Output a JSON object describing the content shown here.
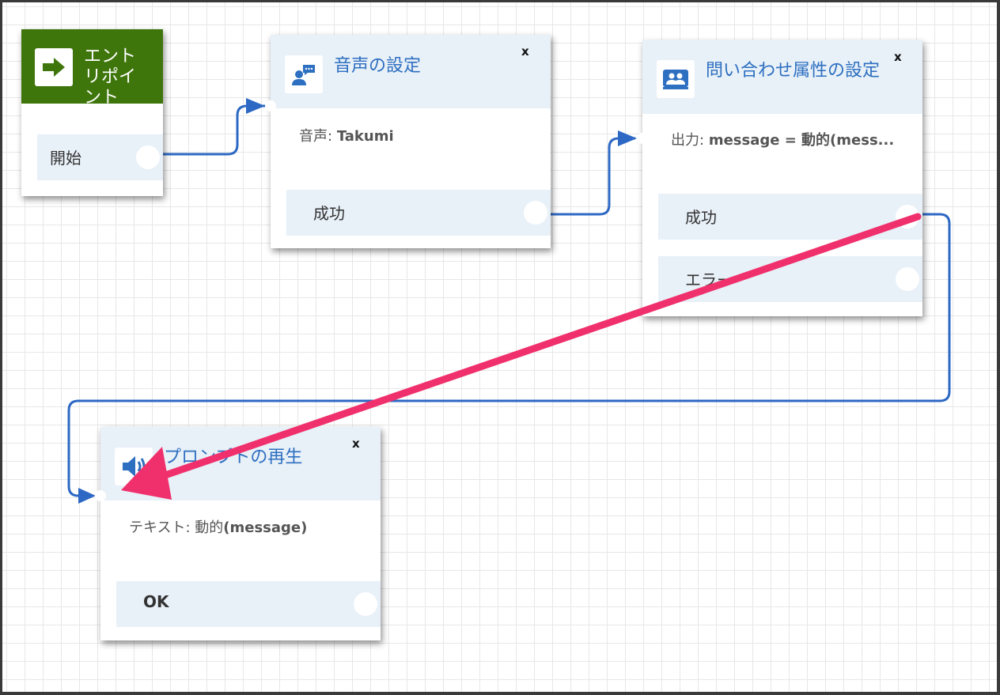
{
  "entry": {
    "title": "エントリポイント",
    "branch": "開始"
  },
  "voice": {
    "title": "音声の設定",
    "body_label": "音声:",
    "body_value": "Takumi",
    "close": "x",
    "branch": "成功"
  },
  "attrs": {
    "title": "問い合わせ属性の設定",
    "body_label": "出力:",
    "body_value": "message = 動的(mess...",
    "close": "x",
    "branches": [
      "成功",
      "エラー"
    ]
  },
  "prompt": {
    "title": "プロンプトの再生",
    "body_label": "テキスト: 動的",
    "body_value": "(message)",
    "close": "x",
    "branch": "OK"
  },
  "colors": {
    "entry_header": "#3f760c",
    "accent": "#2d6fc0",
    "wire": "#2d68c4",
    "arrow": "#f0306c",
    "header_bg": "#e8f0f8"
  },
  "icons": {
    "entry": "arrow-right-icon",
    "voice": "person-chat-icon",
    "attrs": "contact-attributes-icon",
    "prompt": "speaker-icon"
  }
}
